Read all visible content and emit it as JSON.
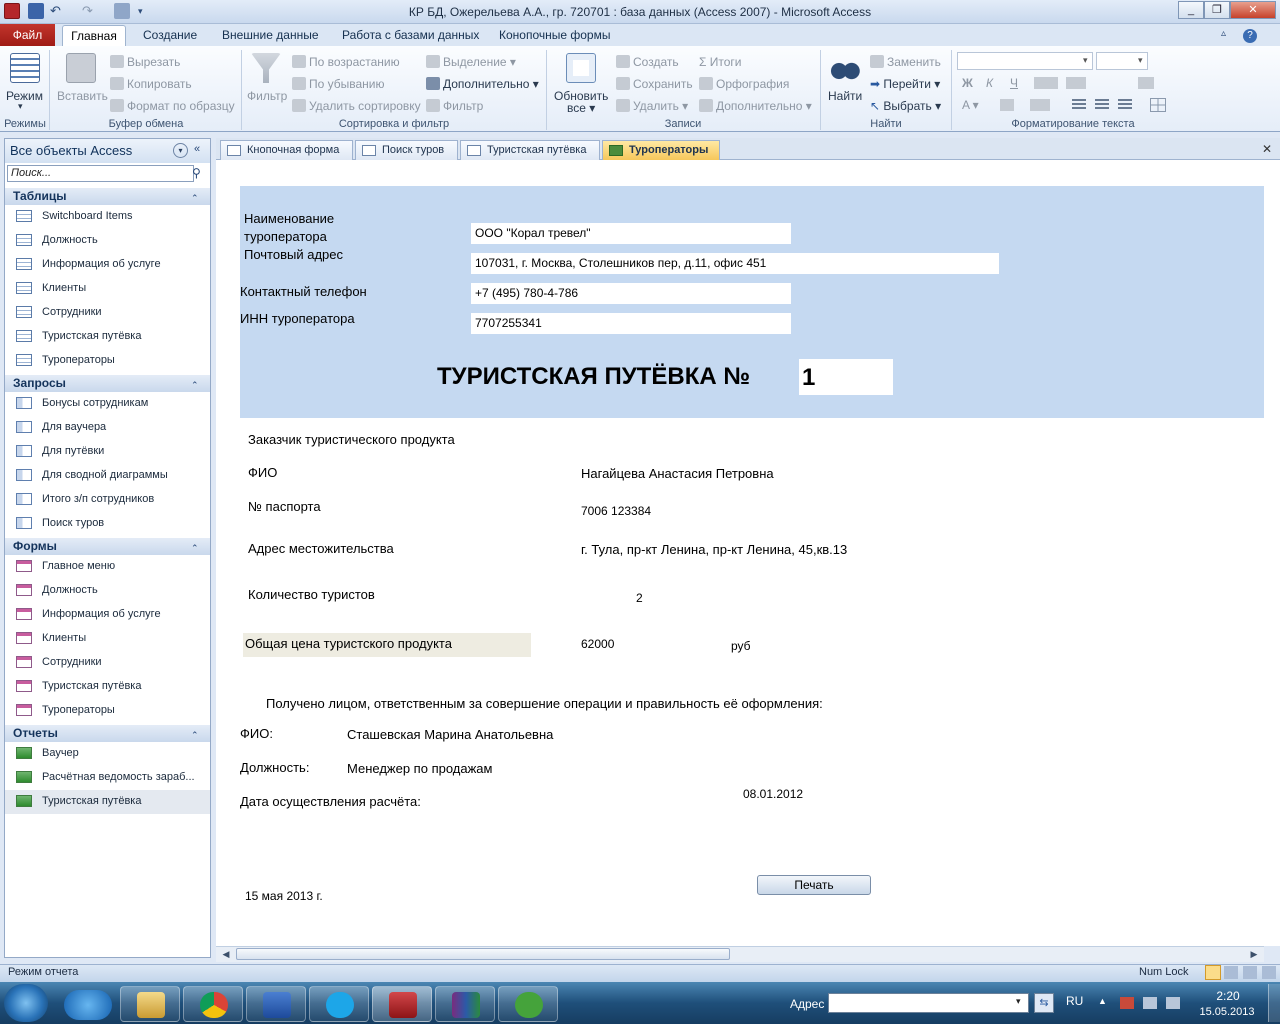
{
  "window": {
    "title": "КР БД, Ожерельева А.А., гр. 720701 : база данных (Access 2007)  -  Microsoft Access"
  },
  "ribbon": {
    "tabs": [
      "Файл",
      "Главная",
      "Создание",
      "Внешние данные",
      "Работа с базами данных",
      "Конопочные формы"
    ],
    "groups": {
      "views": {
        "label": "Режимы",
        "view": "Режим"
      },
      "clipboard": {
        "label": "Буфер обмена",
        "paste": "Вставить",
        "cut": "Вырезать",
        "copy": "Копировать",
        "format_painter": "Формат по образцу"
      },
      "sort": {
        "label": "Сортировка и фильтр",
        "filter": "Фильтр",
        "asc": "По возрастанию",
        "desc": "По убыванию",
        "clear": "Удалить сортировку",
        "selection": "Выделение",
        "advanced": "Дополнительно",
        "toggle": "Фильтр"
      },
      "records": {
        "label": "Записи",
        "refresh": "Обновить",
        "refresh2": "все",
        "new": "Создать",
        "save": "Сохранить",
        "delete": "Удалить",
        "totals": "Итоги",
        "spelling": "Орфография",
        "more": "Дополнительно"
      },
      "find": {
        "label": "Найти",
        "find": "Найти",
        "replace": "Заменить",
        "goto": "Перейти",
        "select": "Выбрать"
      },
      "text": {
        "label": "Форматирование текста",
        "bold": "Ж",
        "italic": "К",
        "underline": "Ч"
      }
    }
  },
  "nav": {
    "title": "Все объекты Access",
    "search_placeholder": "Поиск...",
    "sections": [
      {
        "title": "Таблицы",
        "items": [
          "Switchboard Items",
          "Должность",
          "Информация об услуге",
          "Клиенты",
          "Сотрудники",
          "Туристская путёвка",
          "Туроператоры"
        ]
      },
      {
        "title": "Запросы",
        "items": [
          "Бонусы сотрудникам",
          "Для ваучера",
          "Для путёвки",
          "Для сводной диаграммы",
          "Итого з/п сотрудников",
          "Поиск туров"
        ]
      },
      {
        "title": "Формы",
        "items": [
          "Главное меню",
          "Должность",
          "Информация об услуге",
          "Клиенты",
          "Сотрудники",
          "Туристская путёвка",
          "Туроператоры"
        ]
      },
      {
        "title": "Отчеты",
        "items": [
          "Ваучер",
          "Расчётная ведомость зараб...",
          "Туристская путёвка"
        ]
      }
    ]
  },
  "doc_tabs": [
    "Кнопочная форма",
    "Поиск туров",
    "Туристская путёвка",
    "Туроператоры"
  ],
  "report": {
    "operator_name_label_1": "Наименование",
    "operator_name_label_2": "туроператора",
    "operator_name": "ООО \"Корал тревел\"",
    "address_label": "Почтовый адрес",
    "address": "107031, г. Москва, Столешников пер, д.11, офис 451",
    "phone_label": "Контактный телефон",
    "phone": "+7 (495) 780-4-786",
    "inn_label": "ИНН туроператора",
    "inn": "7707255341",
    "title": "ТУРИСТСКАЯ ПУТЁВКА №",
    "number": "1",
    "customer_header": "Заказчик туристического продукта",
    "fio_label": "ФИО",
    "fio": "Нагайцева Анастасия Петровна",
    "passport_label": "№ паспорта",
    "passport": "7006 123384",
    "residence_label": "Адрес местожительства",
    "residence": "г. Тула, пр-кт Ленина, пр-кт Ленина, 45,кв.13",
    "tourists_label": "Количество туристов",
    "tourists": "2",
    "price_label": "Общая цена туристского продукта",
    "price": "62000",
    "currency": "руб",
    "received_text": "Получено лицом, ответственным за совершение операции и правильность её оформления:",
    "emp_fio_label": "ФИО:",
    "emp_fio": "Сташевская Марина Анатольевна",
    "position_label": "Должность:",
    "position": "Менеджер по продажам",
    "calc_date_label": "Дата осуществления расчёта:",
    "calc_date": "08.01.2012",
    "print_date": "15 мая 2013 г.",
    "print_button": "Печать"
  },
  "status": {
    "left": "Режим отчета",
    "numlock": "Num Lock"
  },
  "taskbar": {
    "address_label": "Адрес",
    "lang": "RU",
    "time": "2:20",
    "date": "15.05.2013"
  },
  "colors": {
    "band": "#c5d9f1",
    "price_bg": "#eeece1",
    "file_tab": "#b02a22",
    "active_tab": "#f6c75b"
  }
}
